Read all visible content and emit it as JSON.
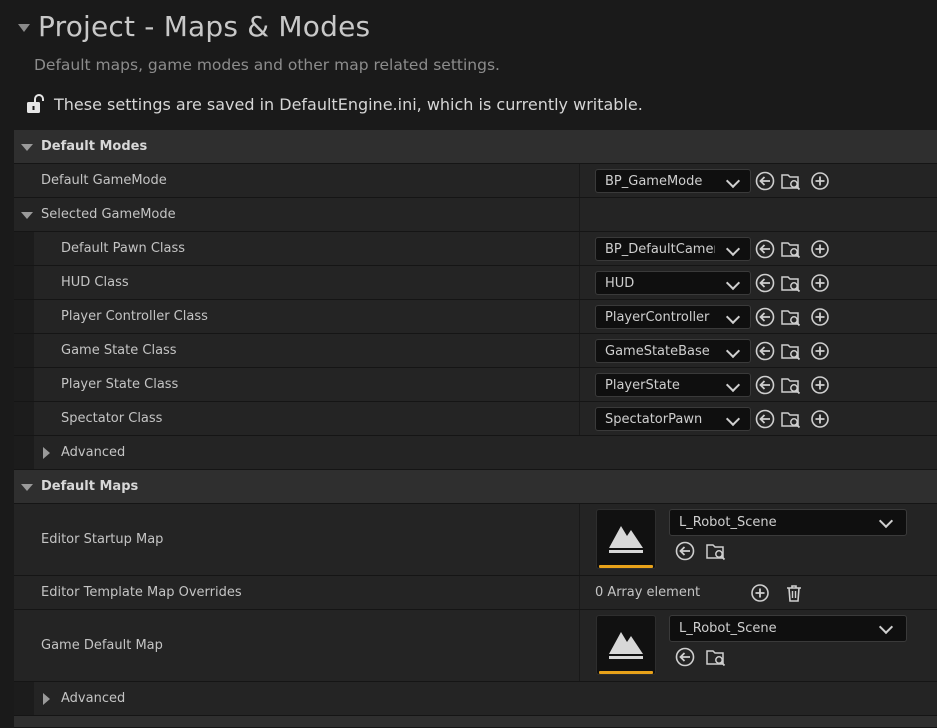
{
  "header": {
    "title": "Project - Maps & Modes",
    "subtitle": "Default maps, game modes and other map related settings.",
    "notice": "These settings are saved in DefaultEngine.ini, which is currently writable."
  },
  "default_modes": {
    "label": "Default Modes",
    "default_gamemode": {
      "label": "Default GameMode",
      "value": "BP_GameMode"
    },
    "selected_gamemode": {
      "label": "Selected GameMode",
      "items": [
        {
          "label": "Default Pawn Class",
          "value": "BP_DefaultCamera"
        },
        {
          "label": "HUD Class",
          "value": "HUD"
        },
        {
          "label": "Player Controller Class",
          "value": "PlayerController"
        },
        {
          "label": "Game State Class",
          "value": "GameStateBase"
        },
        {
          "label": "Player State Class",
          "value": "PlayerState"
        },
        {
          "label": "Spectator Class",
          "value": "SpectatorPawn"
        }
      ],
      "advanced_label": "Advanced"
    }
  },
  "default_maps": {
    "label": "Default Maps",
    "editor_startup_map": {
      "label": "Editor Startup Map",
      "value": "L_Robot_Scene"
    },
    "editor_template_overrides": {
      "label": "Editor Template Map Overrides",
      "value": "0 Array element"
    },
    "game_default_map": {
      "label": "Game Default Map",
      "value": "L_Robot_Scene"
    },
    "advanced_label": "Advanced"
  },
  "colors": {
    "background": "#1a1a1a",
    "panel": "#242424",
    "category": "#2f2f2f",
    "accent": "#e8a21a"
  },
  "icons": [
    "lock-open-icon",
    "browse-back-icon",
    "find-in-browser-icon",
    "add-icon",
    "delete-icon",
    "map-thumbnail-icon"
  ]
}
